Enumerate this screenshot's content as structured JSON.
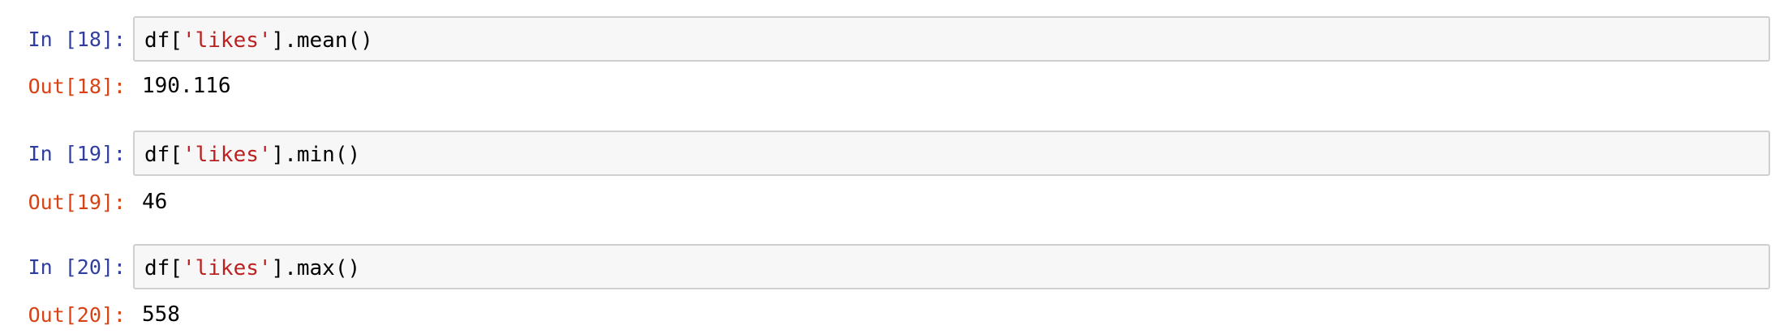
{
  "cells": [
    {
      "in_prompt": "In [18]:",
      "code_prefix": "df[",
      "code_string": "'likes'",
      "code_suffix": "].mean()",
      "out_prompt": "Out[18]:",
      "output": "190.116"
    },
    {
      "in_prompt": "In [19]:",
      "code_prefix": "df[",
      "code_string": "'likes'",
      "code_suffix": "].min()",
      "out_prompt": "Out[19]:",
      "output": "46"
    },
    {
      "in_prompt": "In [20]:",
      "code_prefix": "df[",
      "code_string": "'likes'",
      "code_suffix": "].max()",
      "out_prompt": "Out[20]:",
      "output": "558"
    }
  ],
  "colors": {
    "in_prompt": "#303f9f",
    "out_prompt": "#d84315",
    "string_literal": "#ba2121",
    "input_background": "#f7f7f7",
    "input_border": "#cfcfcf"
  }
}
